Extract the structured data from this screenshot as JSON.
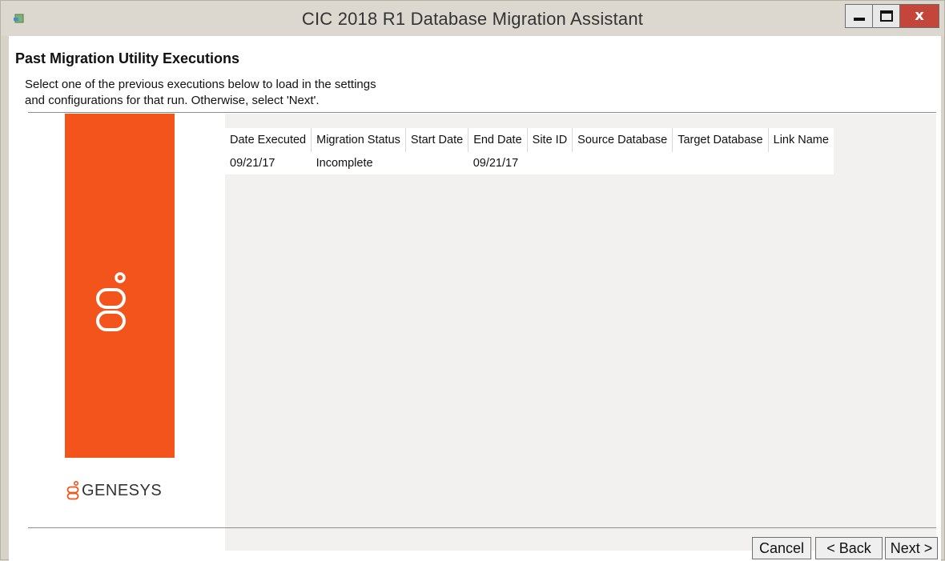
{
  "window": {
    "title": "CIC 2018 R1 Database Migration Assistant",
    "close_glyph": "x"
  },
  "page": {
    "title": "Past Migration Utility Executions",
    "description_line1": "Select one of the previous executions below to load in the settings",
    "description_line2": "and configurations for that run.  Otherwise, select 'Next'."
  },
  "brand": {
    "panel_color": "#f2541b",
    "logo_text": "GENESYS"
  },
  "table": {
    "columns": [
      "Date Executed",
      "Migration Status",
      "Start Date",
      "End Date",
      "Site ID",
      "Source Database",
      "Target Database",
      "Link Name"
    ],
    "rows": [
      [
        "09/21/17",
        "Incomplete",
        "",
        "09/21/17",
        "",
        "",
        "",
        ""
      ]
    ]
  },
  "buttons": {
    "cancel": "Cancel",
    "back": "< Back",
    "next": "Next >"
  }
}
